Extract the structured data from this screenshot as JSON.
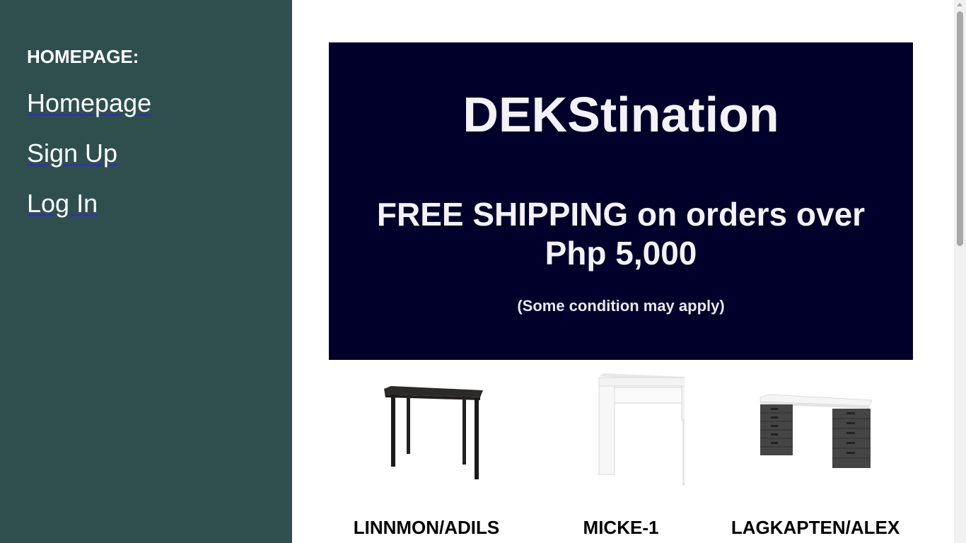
{
  "sidebar": {
    "heading": "HOMEPAGE:",
    "links": [
      {
        "label": "Homepage"
      },
      {
        "label": "Sign Up"
      },
      {
        "label": "Log In"
      }
    ]
  },
  "banner": {
    "title": "DEKStination",
    "subtitle": "FREE SHIPPING on orders over Php 5,000",
    "note": "(Some condition may apply)"
  },
  "products": [
    {
      "name": "LINNMON/ADILS",
      "image": "black-table-with-four-legs"
    },
    {
      "name": "MICKE-1",
      "image": "white-desk-with-drawer"
    },
    {
      "name": "LAGKAPTEN/ALEX",
      "image": "white-desk-with-two-drawer-units"
    }
  ],
  "colors": {
    "sidebar_bg": "#2f4f4f",
    "banner_bg": "#00002a",
    "banner_text": "#f2f2f8"
  }
}
